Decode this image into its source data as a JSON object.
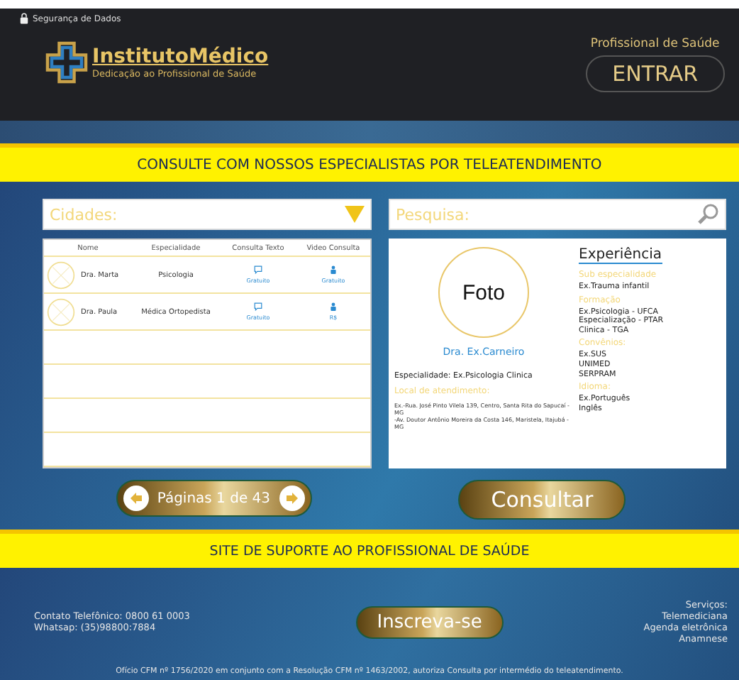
{
  "header": {
    "security_note": "Segurança de Dados",
    "logo": {
      "name": "InstitutoMédico",
      "tagline": "Dedicação ao Profissional de Saúde"
    },
    "login_label": "Profissional de Saúde",
    "login_button": "ENTRAR"
  },
  "banner": "CONSULTE COM NOSSOS ESPECIALISTAS POR TELEATENDIMENTO",
  "city_filter": {
    "placeholder": "Cidades:"
  },
  "search": {
    "placeholder": "Pesquisa:"
  },
  "table": {
    "columns": [
      "Nome",
      "Especialidade",
      "Consulta Texto",
      "Video Consulta"
    ],
    "rows": [
      {
        "name": "Dra. Marta",
        "specialty": "Psicologia",
        "text_price": "Gratuito",
        "video_price": "Gratuito"
      },
      {
        "name": "Dra. Paula",
        "specialty": "Médica Ortopedista",
        "text_price": "Gratuito",
        "video_price": "R$"
      }
    ]
  },
  "profile": {
    "photo": "Foto",
    "name": "Dra. Ex.Carneiro",
    "specialty_label": "Especialidade:",
    "specialty": "Ex.Psicologia Clinica",
    "location_title": "Local de atendimento:",
    "locations": [
      "Ex.-Rua. José Pinto Vilela 139, Centro, Santa Rita do Sapucaí - MG",
      "-Av. Doutor Antônio Moreira da Costa 146, Maristela, Itajubá - MG"
    ],
    "experience_title": "Experiência",
    "sections": [
      {
        "title": "Sub especialidade",
        "lines": [
          "Ex.Trauma infantil"
        ]
      },
      {
        "title": "Formação",
        "lines": [
          "Ex.Psicologia  - UFCA",
          "Especialização - PTAR",
          "Clinica - TGA"
        ]
      },
      {
        "title": "Convênios:",
        "lines": [
          "Ex.SUS",
          "UNIMED",
          "SERPRAM"
        ]
      },
      {
        "title": "Idioma:",
        "lines": [
          "Ex.Português",
          "Inglês"
        ]
      }
    ]
  },
  "pagination": "Páginas 1 de 43",
  "consult_button": "Consultar",
  "support_banner": "SITE DE SUPORTE AO PROFISSIONAL DE SAÚDE",
  "footer": {
    "contacts": [
      "Contato Telefônico: 0800 61 0003",
      "Whatsap: (35)98800:7884"
    ],
    "signup_button": "Inscreva-se",
    "services": [
      "Serviços:",
      "Telemediciana",
      "Agenda eletrônica",
      "Anamnese"
    ],
    "legal": "Ofício CFM nº 1756/2020 em conjunto com a Resolução CFM nº 1463/2002, autoriza Consulta por intermédio do teleatendimento."
  }
}
